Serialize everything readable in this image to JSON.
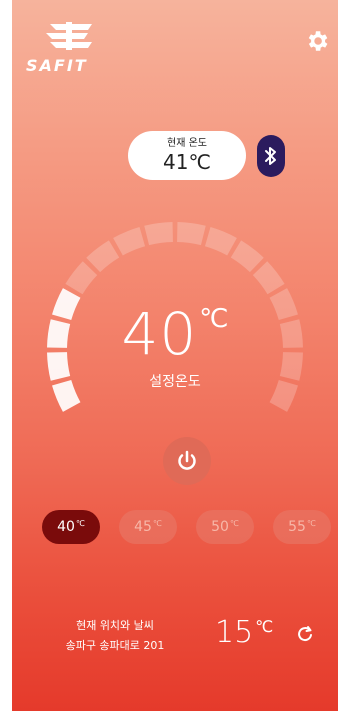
{
  "app": {
    "brand": "SAFIT"
  },
  "current": {
    "label": "현재 온도",
    "value": "41℃"
  },
  "setpoint": {
    "value": "40",
    "unit": "℃",
    "label": "설정온도"
  },
  "presets": [
    {
      "value": "40",
      "unit": "℃",
      "active": true
    },
    {
      "value": "45",
      "unit": "℃",
      "active": false
    },
    {
      "value": "50",
      "unit": "℃",
      "active": false
    },
    {
      "value": "55",
      "unit": "℃",
      "active": false
    }
  ],
  "weather": {
    "title": "현재 위치와 날씨",
    "address": "송파구 송파대로 201",
    "temp": "15",
    "unit": "℃"
  },
  "dial": {
    "segments_total": 16,
    "segments_active": 4
  },
  "colors": {
    "active_preset": "#7a0b0b",
    "bluetooth": "#2b1b5e",
    "gradient_top": "#f6b39c",
    "gradient_bottom": "#e53a2b"
  },
  "icons": {
    "settings": "gear-icon",
    "bluetooth": "bluetooth-icon",
    "power": "power-icon",
    "refresh": "refresh-icon"
  }
}
